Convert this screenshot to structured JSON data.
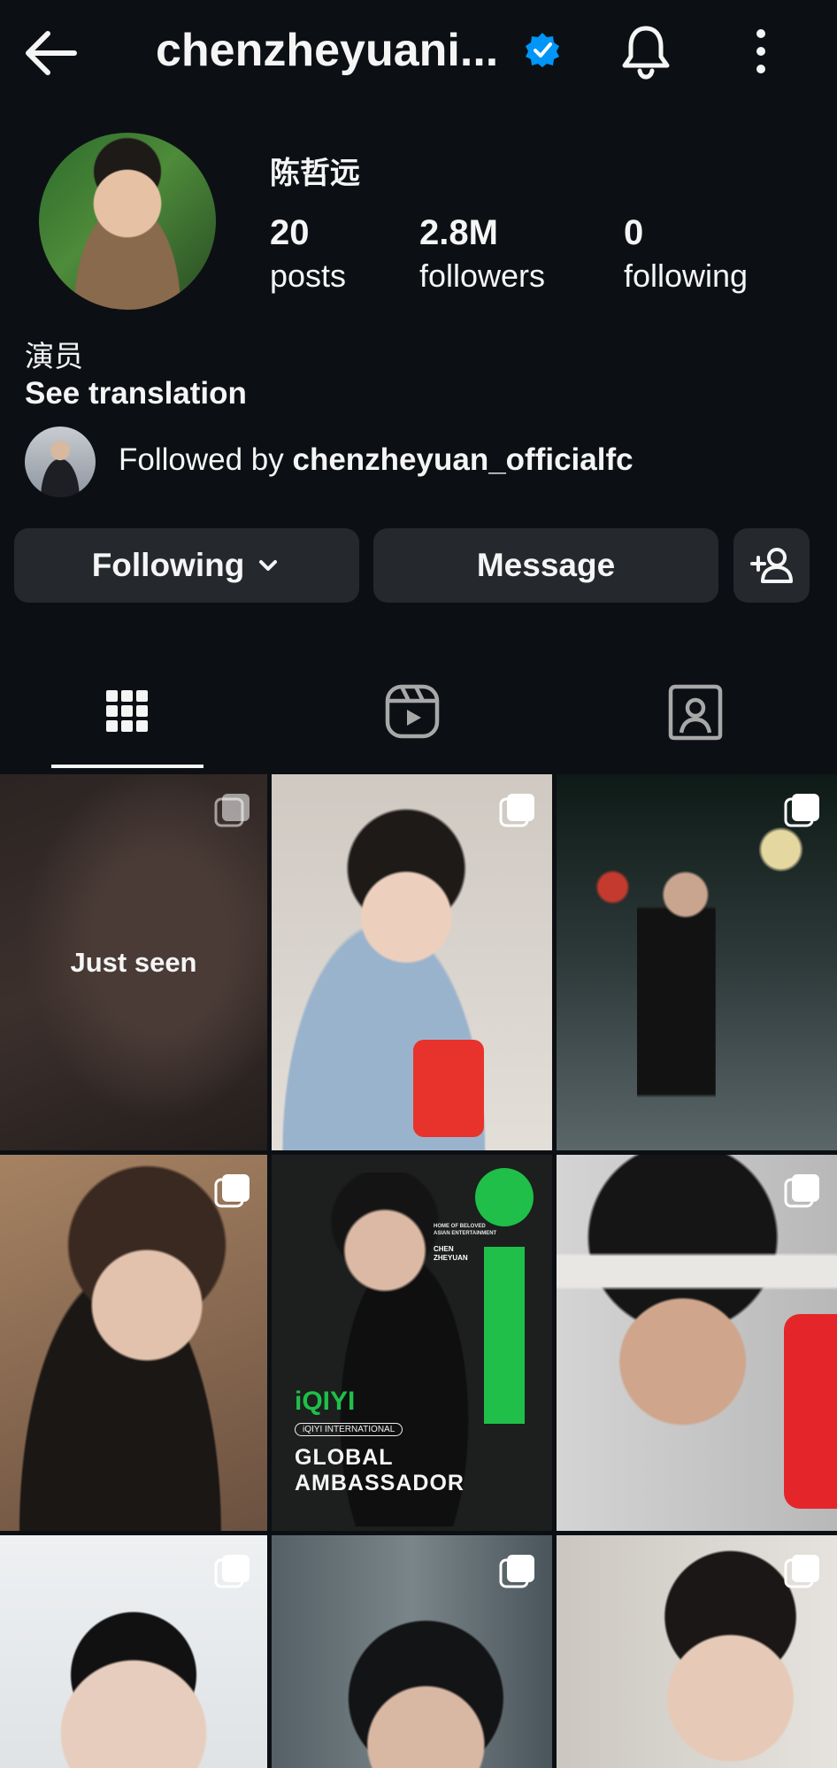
{
  "header": {
    "handle": "chenzheyuani...",
    "verified": true,
    "accent_color": "#0095f6"
  },
  "profile": {
    "display_name": "陈哲远",
    "stats": [
      {
        "value": "20",
        "label": "posts"
      },
      {
        "value": "2.8M",
        "label": "followers"
      },
      {
        "value": "0",
        "label": "following"
      }
    ],
    "bio": "演员",
    "see_translation": "See translation",
    "followed_by_prefix": "Followed by ",
    "followed_by_user": "chenzheyuan_officialfc"
  },
  "actions": {
    "following_label": "Following",
    "message_label": "Message",
    "add_user_icon": "add-person-icon"
  },
  "tabs": [
    {
      "name": "grid",
      "icon": "grid-icon",
      "active": true
    },
    {
      "name": "reels",
      "icon": "reels-icon",
      "active": false
    },
    {
      "name": "tagged",
      "icon": "tagged-icon",
      "active": false
    }
  ],
  "grid": {
    "just_seen_label": "Just seen",
    "poster": {
      "tagline": "HOME OF BELOVED\nASIAN ENTERTAINMENT",
      "name": "CHEN\nZHEYUAN",
      "brand": "iQIYI",
      "intl": "iQIYI INTERNATIONAL",
      "headline": "GLOBAL\nAMBASSADOR",
      "brand_color": "#1fbf4a"
    }
  }
}
